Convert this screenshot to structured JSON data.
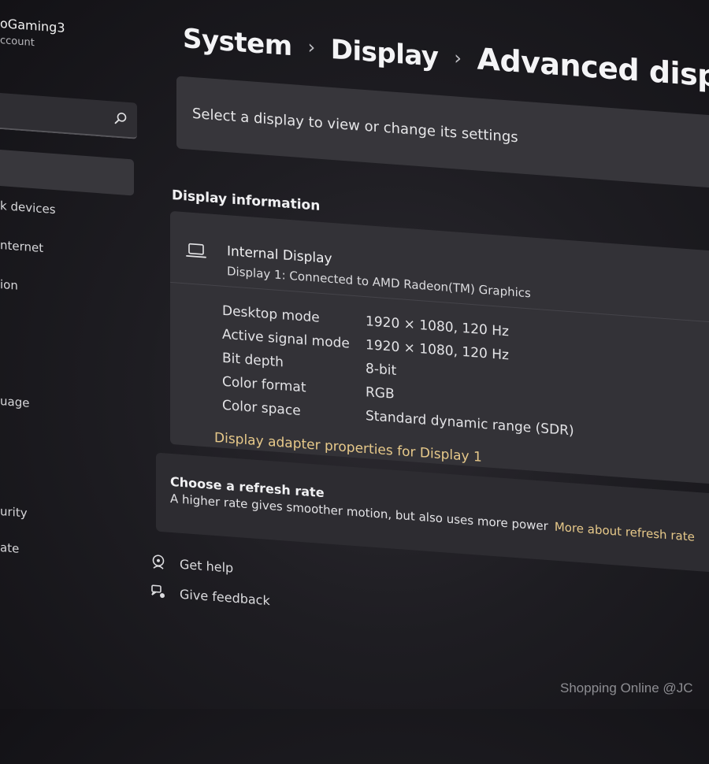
{
  "sidebar": {
    "account_name": "oGaming3",
    "account_sub": "ccount",
    "items": [
      {
        "label": "k devices"
      },
      {
        "label": "nternet"
      },
      {
        "label": "ion"
      },
      {
        "label": "uage"
      },
      {
        "label": "urity"
      },
      {
        "label": "ate"
      }
    ]
  },
  "header": {
    "breadcrumb": [
      "System",
      "Display",
      "Advanced displa"
    ],
    "separator": "›"
  },
  "select_display": {
    "text": "Select a display to view or change its settings"
  },
  "display_info": {
    "section_title": "Display information",
    "name": "Internal Display",
    "subtitle": "Display 1: Connected to AMD Radeon(TM) Graphics",
    "properties": [
      {
        "label": "Desktop mode",
        "value": "1920 × 1080, 120 Hz"
      },
      {
        "label": "Active signal mode",
        "value": "1920 × 1080, 120 Hz"
      },
      {
        "label": "Bit depth",
        "value": "8-bit"
      },
      {
        "label": "Color format",
        "value": "RGB"
      },
      {
        "label": "Color space",
        "value": "Standard dynamic range (SDR)"
      }
    ],
    "adapter_link": "Display adapter properties for Display 1"
  },
  "refresh": {
    "title": "Choose a refresh rate",
    "description": "A higher rate gives smoother motion, but also uses more power",
    "link": "More about refresh rate"
  },
  "footer_links": {
    "help": "Get help",
    "feedback": "Give feedback"
  },
  "watermark": "Shopping Online @JC",
  "colors": {
    "accent_link": "#e7c98a",
    "card_bg": "#333237",
    "page_bg": "#1e1d22"
  },
  "icons": [
    "search-icon",
    "laptop-icon",
    "help-icon",
    "feedback-icon"
  ]
}
